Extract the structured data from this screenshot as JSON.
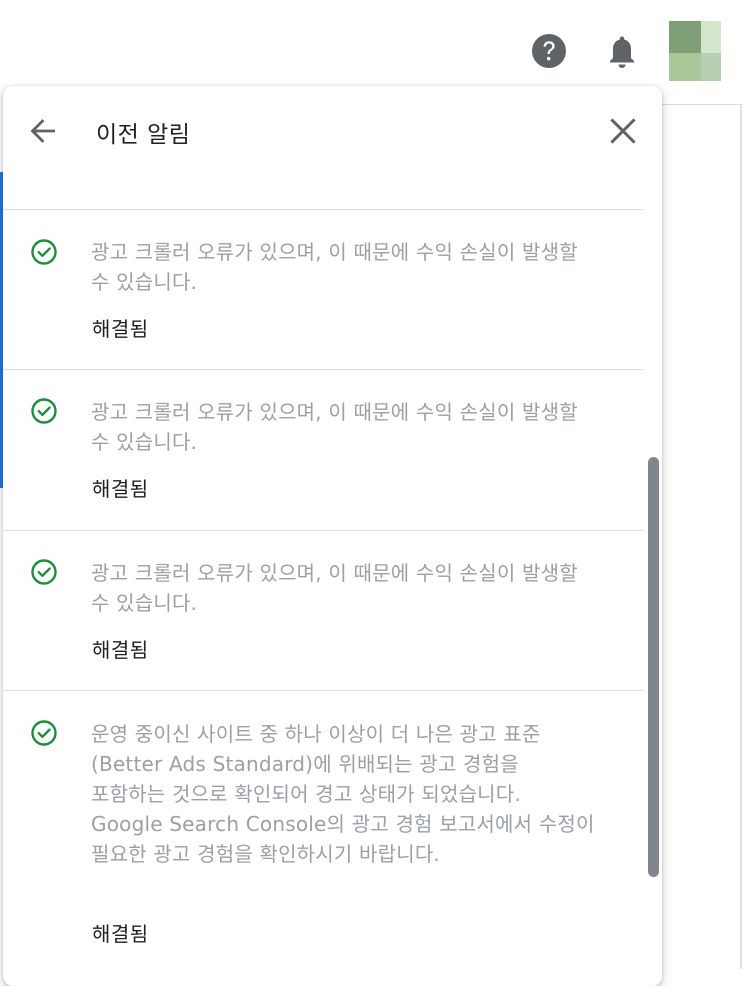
{
  "panel": {
    "title": "이전 알림"
  },
  "notifications": [
    {
      "message": "광고 크롤러 오류가 있으며, 이 때문에 수익 손실이 발생할 수 있습니다.",
      "status": "해결됨"
    },
    {
      "message": "광고 크롤러 오류가 있으며, 이 때문에 수익 손실이 발생할 수 있습니다.",
      "status": "해결됨"
    },
    {
      "message": "광고 크롤러 오류가 있으며, 이 때문에 수익 손실이 발생할 수 있습니다.",
      "status": "해결됨"
    },
    {
      "message": "운영 중이신 사이트 중 하나 이상이 더 나은 광고 표준(Better Ads Standard)에 위배되는 광고 경험을 포함하는 것으로 확인되어 경고 상태가 되었습니다. Google Search Console의 광고 경험 보고서에서 수정이 필요한 광고 경험을 확인하시기 바랍니다.",
      "status": "해결됨"
    }
  ],
  "icons": {
    "help": "help-icon",
    "notifications": "bell-icon",
    "back": "arrow-back-icon",
    "close": "close-icon",
    "resolved": "check-circle-icon"
  },
  "colors": {
    "resolved_green": "#1e8e3e",
    "message_gray": "#9aa0a6",
    "text_dark": "#202124",
    "icon_gray": "#5f6368",
    "scrollbar": "#80868b",
    "accent_blue": "#1a73e8"
  }
}
